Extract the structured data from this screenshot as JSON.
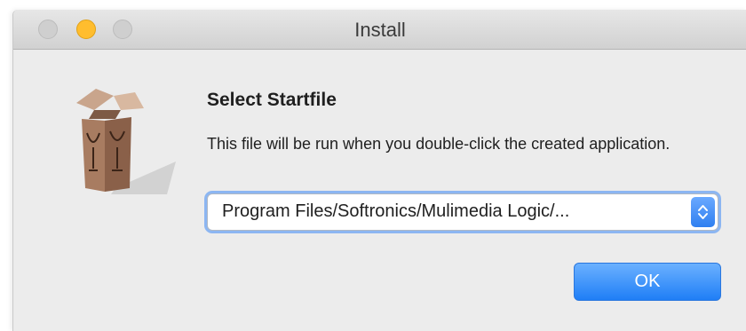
{
  "window": {
    "title": "Install"
  },
  "dialog": {
    "heading": "Select Startfile",
    "description": "This file will be run when you double-click the created application.",
    "startfile_selected": "Program Files/Softronics/Mulimedia Logic/...",
    "ok_label": "OK"
  },
  "icons": {
    "app": "wine-bottle-box-icon",
    "popup_arrows": "chevron-up-down-icon"
  },
  "colors": {
    "accent": "#2f7ff0",
    "focus_ring": "#8cb6f2",
    "minimize": "#ffbd2e"
  }
}
